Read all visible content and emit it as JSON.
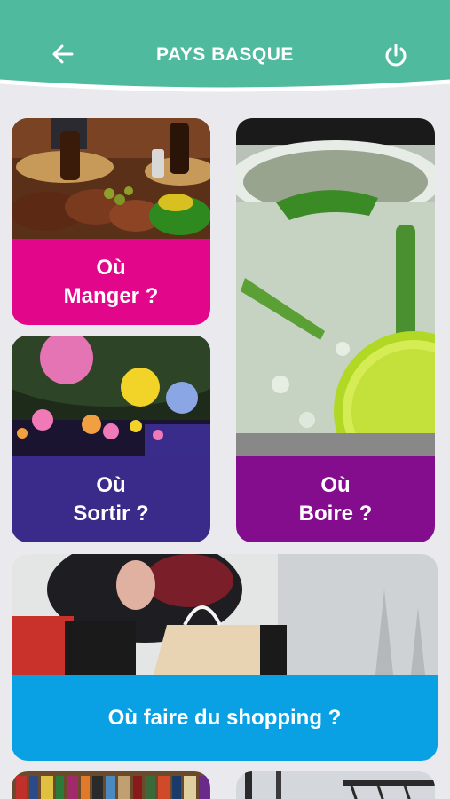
{
  "header": {
    "title": "PAYS BASQUE",
    "back_icon": "arrow-left-icon",
    "power_icon": "power-icon",
    "color": "#4fba9e"
  },
  "cards": {
    "manger": {
      "label": "Où\nManger ?",
      "color": "#e1068a"
    },
    "sortir": {
      "label": "Où\nSortir ?",
      "color": "#3a2a8a"
    },
    "boire": {
      "label": "Où\nBoire ?",
      "color": "#840d8e"
    },
    "shopping": {
      "label": "Où faire du shopping ?",
      "color": "#0aa0e4"
    }
  }
}
